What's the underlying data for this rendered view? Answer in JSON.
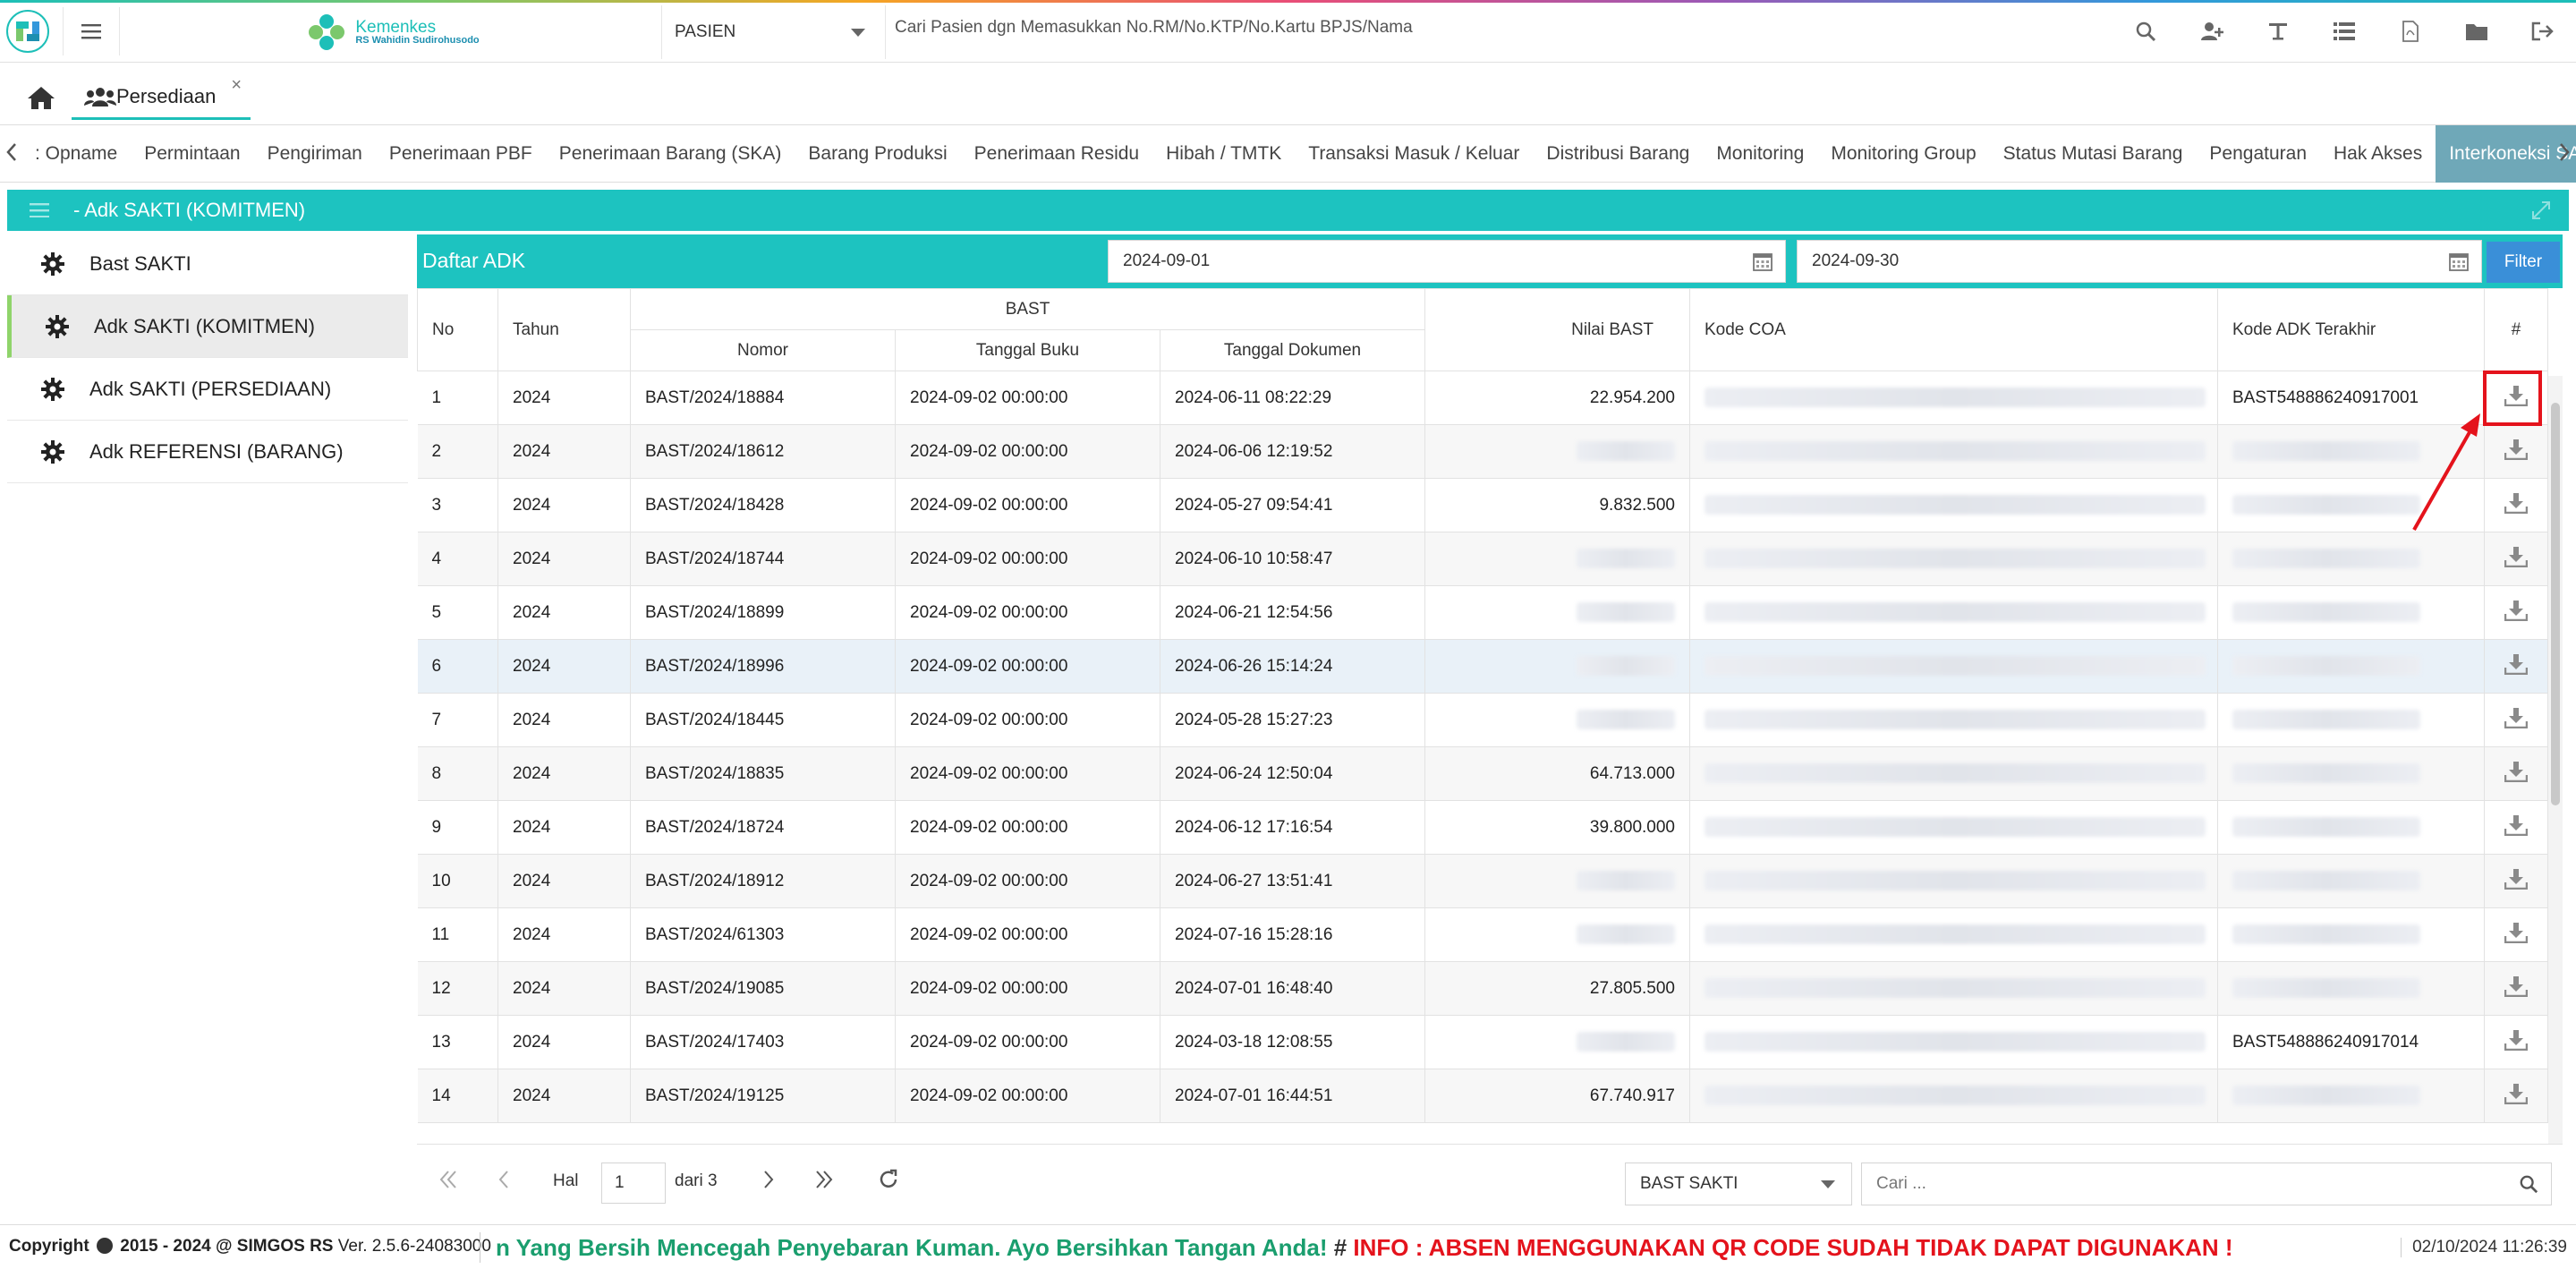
{
  "header": {
    "brand_line1": "Kemenkes",
    "brand_line2": "RS Wahidin Sudirohusodo",
    "patient_type": "PASIEN",
    "search_placeholder": "Cari Pasien dgn Memasukkan No.RM/No.KTP/No.Kartu BPJS/Nama",
    "icons": [
      "search-icon",
      "add-user-icon",
      "text-icon",
      "list-icon",
      "pdf-icon",
      "folder-icon",
      "logout-icon"
    ]
  },
  "tabs": {
    "active_label": "Persediaan",
    "close_symbol": "×"
  },
  "module_menu": {
    "items": [
      "Opname",
      "Permintaan",
      "Pengiriman",
      "Penerimaan PBF",
      "Penerimaan Barang (SKA)",
      "Barang Produksi",
      "Penerimaan Residu",
      "Hibah / TMTK",
      "Transaksi Masuk / Keluar",
      "Distribusi Barang",
      "Monitoring",
      "Monitoring Group",
      "Status Mutasi Barang",
      "Pengaturan",
      "Hak Akses",
      "Interkoneksi SAKTI"
    ],
    "active_index": 15,
    "truncated_prefix": ": "
  },
  "panel": {
    "title": "- Adk SAKTI (KOMITMEN)"
  },
  "side_menu": {
    "items": [
      "Bast SAKTI",
      "Adk SAKTI (KOMITMEN)",
      "Adk SAKTI (PERSEDIAAN)",
      "Adk REFERENSI (BARANG)"
    ],
    "active_index": 1
  },
  "grid": {
    "title": "Daftar ADK",
    "date_from": "2024-09-01",
    "date_to": "2024-09-30",
    "filter_label": "Filter",
    "columns": {
      "no": "No",
      "tahun": "Tahun",
      "bast": "BAST",
      "nomor": "Nomor",
      "tgl_buku": "Tanggal Buku",
      "tgl_dok": "Tanggal Dokumen",
      "nilai": "Nilai BAST",
      "coa": "Kode COA",
      "adk": "Kode ADK Terakhir",
      "act": "#"
    },
    "rows": [
      {
        "no": "1",
        "tahun": "2024",
        "nomor": "BAST/2024/18884",
        "tgl_buku": "2024-09-02 00:00:00",
        "tgl_dok": "2024-06-11 08:22:29",
        "nilai": "22.954.200",
        "adk": "BAST548886240917001"
      },
      {
        "no": "2",
        "tahun": "2024",
        "nomor": "BAST/2024/18612",
        "tgl_buku": "2024-09-02 00:00:00",
        "tgl_dok": "2024-06-06 12:19:52",
        "nilai": "",
        "adk": ""
      },
      {
        "no": "3",
        "tahun": "2024",
        "nomor": "BAST/2024/18428",
        "tgl_buku": "2024-09-02 00:00:00",
        "tgl_dok": "2024-05-27 09:54:41",
        "nilai": "9.832.500",
        "adk": ""
      },
      {
        "no": "4",
        "tahun": "2024",
        "nomor": "BAST/2024/18744",
        "tgl_buku": "2024-09-02 00:00:00",
        "tgl_dok": "2024-06-10 10:58:47",
        "nilai": "",
        "adk": ""
      },
      {
        "no": "5",
        "tahun": "2024",
        "nomor": "BAST/2024/18899",
        "tgl_buku": "2024-09-02 00:00:00",
        "tgl_dok": "2024-06-21 12:54:56",
        "nilai": "",
        "adk": ""
      },
      {
        "no": "6",
        "tahun": "2024",
        "nomor": "BAST/2024/18996",
        "tgl_buku": "2024-09-02 00:00:00",
        "tgl_dok": "2024-06-26 15:14:24",
        "nilai": "",
        "adk": ""
      },
      {
        "no": "7",
        "tahun": "2024",
        "nomor": "BAST/2024/18445",
        "tgl_buku": "2024-09-02 00:00:00",
        "tgl_dok": "2024-05-28 15:27:23",
        "nilai": "",
        "adk": ""
      },
      {
        "no": "8",
        "tahun": "2024",
        "nomor": "BAST/2024/18835",
        "tgl_buku": "2024-09-02 00:00:00",
        "tgl_dok": "2024-06-24 12:50:04",
        "nilai": "64.713.000",
        "adk": ""
      },
      {
        "no": "9",
        "tahun": "2024",
        "nomor": "BAST/2024/18724",
        "tgl_buku": "2024-09-02 00:00:00",
        "tgl_dok": "2024-06-12 17:16:54",
        "nilai": "39.800.000",
        "adk": ""
      },
      {
        "no": "10",
        "tahun": "2024",
        "nomor": "BAST/2024/18912",
        "tgl_buku": "2024-09-02 00:00:00",
        "tgl_dok": "2024-06-27 13:51:41",
        "nilai": "",
        "adk": ""
      },
      {
        "no": "11",
        "tahun": "2024",
        "nomor": "BAST/2024/61303",
        "tgl_buku": "2024-09-02 00:00:00",
        "tgl_dok": "2024-07-16 15:28:16",
        "nilai": "",
        "adk": ""
      },
      {
        "no": "12",
        "tahun": "2024",
        "nomor": "BAST/2024/19085",
        "tgl_buku": "2024-09-02 00:00:00",
        "tgl_dok": "2024-07-01 16:48:40",
        "nilai": "27.805.500",
        "adk": ""
      },
      {
        "no": "13",
        "tahun": "2024",
        "nomor": "BAST/2024/17403",
        "tgl_buku": "2024-09-02 00:00:00",
        "tgl_dok": "2024-03-18 12:08:55",
        "nilai": "",
        "adk": "BAST548886240917014"
      },
      {
        "no": "14",
        "tahun": "2024",
        "nomor": "BAST/2024/19125",
        "tgl_buku": "2024-09-02 00:00:00",
        "tgl_dok": "2024-07-01 16:44:51",
        "nilai": "67.740.917",
        "adk": ""
      }
    ],
    "alt_rows": [
      1,
      3,
      5,
      7,
      9,
      11,
      13
    ],
    "highlight_row": 5
  },
  "pager": {
    "hal_label": "Hal",
    "page": "1",
    "of_label": "dari 3",
    "source": "BAST SAKTI",
    "search_placeholder": "Cari ..."
  },
  "footer": {
    "copyright": "Copyright",
    "copyright_rest": "2015 - 2024 @ SIMGOS RS",
    "version": "Ver. 2.5.6-24083000",
    "marquee_green": "n Yang Bersih Mencegah Penyebaran Kuman. Ayo Bersihkan Tangan Anda!",
    "marquee_hash": " # ",
    "marquee_red": "INFO : ABSEN MENGGUNAKAN QR CODE SUDAH TIDAK DAPAT DIGUNAKAN !",
    "datetime": "02/10/2024 11:26:39"
  },
  "colors": {
    "accent": "#1dc3c0",
    "active_menu": "#6fa8b8",
    "filter": "#3a8fd8",
    "annotation": "#e4131c"
  }
}
